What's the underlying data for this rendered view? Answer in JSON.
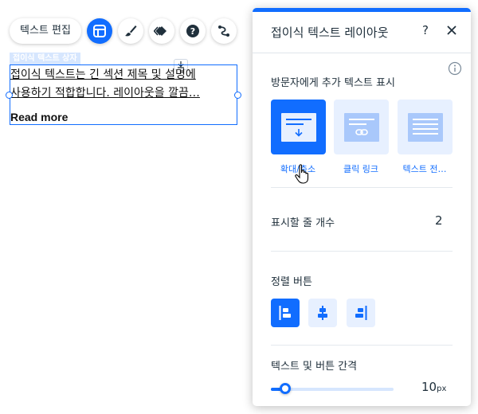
{
  "toolbar": {
    "edit_text_label": "텍스트 편집",
    "icons": [
      "layout-icon",
      "paint-brush-icon",
      "animation-icon",
      "help-icon",
      "connect-icon"
    ],
    "accent": "#116dff"
  },
  "editor": {
    "element_tag": "접이식 텍스트 상자",
    "paragraph_line1": "접이식 텍스트는 긴 섹션 제목 및 설명에",
    "paragraph_line2": "사용하기 적합합니다. 레이아웃을 깔끔…",
    "read_more": "Read more"
  },
  "panel": {
    "title": "접이식 텍스트 레이아웃",
    "help": "?",
    "display_section": {
      "label": "방문자에게 추가 텍스트 표시",
      "options": [
        {
          "label": "확대/축소",
          "selected": true
        },
        {
          "label": "클릭 링크",
          "selected": false
        },
        {
          "label": "텍스트 전…",
          "selected": false
        }
      ]
    },
    "lines_section": {
      "label": "표시할 줄 개수",
      "value": "2"
    },
    "align_section": {
      "label": "정렬 버튼",
      "options": [
        "left",
        "center",
        "right"
      ],
      "selected": "left"
    },
    "spacing_section": {
      "label": "텍스트 및 버튼 간격",
      "value": "10",
      "unit": "px",
      "slider_fraction": 0.12
    }
  }
}
